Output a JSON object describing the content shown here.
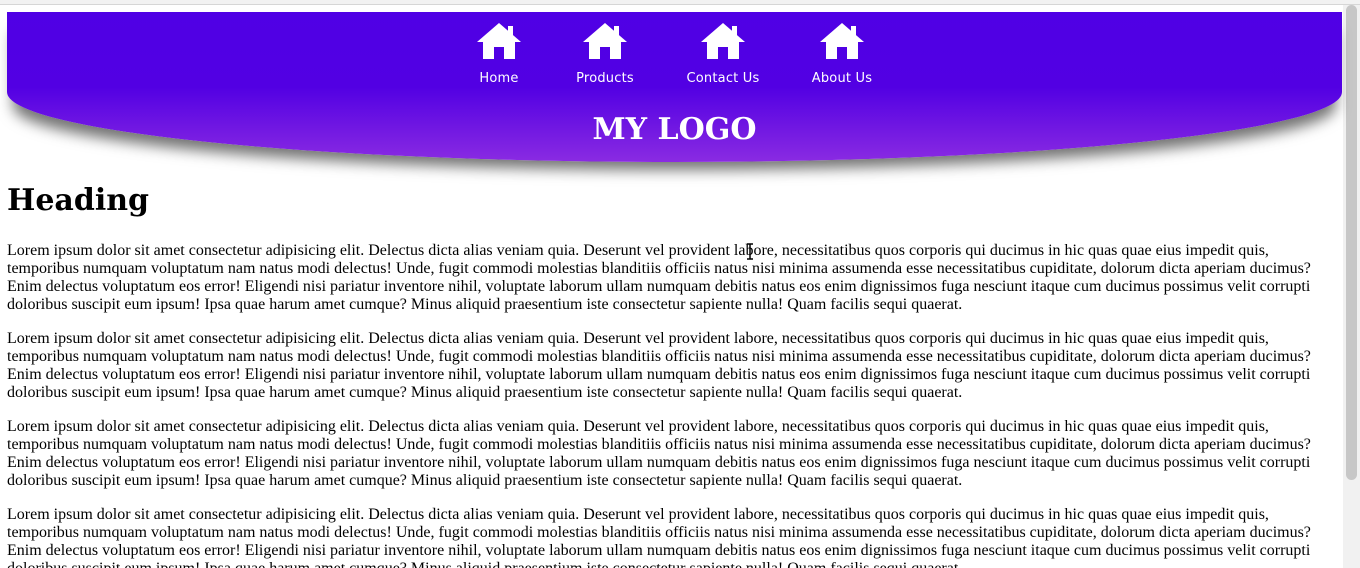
{
  "nav": {
    "items": [
      {
        "label": "Home",
        "icon": "home-icon"
      },
      {
        "label": "Products",
        "icon": "home-icon"
      },
      {
        "label": "Contact Us",
        "icon": "home-icon"
      },
      {
        "label": "About Us",
        "icon": "home-icon"
      }
    ]
  },
  "logo": {
    "text": "MY LOGO"
  },
  "colors": {
    "header_top": "#4f00e5",
    "header_bottom": "#8a2be2",
    "nav_text": "#ffffff"
  },
  "main": {
    "heading": "Heading",
    "paragraphs": [
      "Lorem ipsum dolor sit amet consectetur adipisicing elit. Delectus dicta alias veniam quia. Deserunt vel provident labore, necessitatibus quos corporis qui ducimus in hic quas quae eius impedit quis, temporibus numquam voluptatum nam natus modi delectus! Unde, fugit commodi molestias blanditiis officiis natus nisi minima assumenda esse necessitatibus cupiditate, dolorum dicta aperiam ducimus? Enim delectus voluptatum eos error! Eligendi nisi pariatur inventore nihil, voluptate laborum ullam numquam debitis natus eos enim dignissimos fuga nesciunt itaque cum ducimus possimus velit corrupti doloribus suscipit eum ipsum! Ipsa quae harum amet cumque? Minus aliquid praesentium iste consectetur sapiente nulla! Quam facilis sequi quaerat.",
      "Lorem ipsum dolor sit amet consectetur adipisicing elit. Delectus dicta alias veniam quia. Deserunt vel provident labore, necessitatibus quos corporis qui ducimus in hic quas quae eius impedit quis, temporibus numquam voluptatum nam natus modi delectus! Unde, fugit commodi molestias blanditiis officiis natus nisi minima assumenda esse necessitatibus cupiditate, dolorum dicta aperiam ducimus? Enim delectus voluptatum eos error! Eligendi nisi pariatur inventore nihil, voluptate laborum ullam numquam debitis natus eos enim dignissimos fuga nesciunt itaque cum ducimus possimus velit corrupti doloribus suscipit eum ipsum! Ipsa quae harum amet cumque? Minus aliquid praesentium iste consectetur sapiente nulla! Quam facilis sequi quaerat.",
      "Lorem ipsum dolor sit amet consectetur adipisicing elit. Delectus dicta alias veniam quia. Deserunt vel provident labore, necessitatibus quos corporis qui ducimus in hic quas quae eius impedit quis, temporibus numquam voluptatum nam natus modi delectus! Unde, fugit commodi molestias blanditiis officiis natus nisi minima assumenda esse necessitatibus cupiditate, dolorum dicta aperiam ducimus? Enim delectus voluptatum eos error! Eligendi nisi pariatur inventore nihil, voluptate laborum ullam numquam debitis natus eos enim dignissimos fuga nesciunt itaque cum ducimus possimus velit corrupti doloribus suscipit eum ipsum! Ipsa quae harum amet cumque? Minus aliquid praesentium iste consectetur sapiente nulla! Quam facilis sequi quaerat.",
      "Lorem ipsum dolor sit amet consectetur adipisicing elit. Delectus dicta alias veniam quia. Deserunt vel provident labore, necessitatibus quos corporis qui ducimus in hic quas quae eius impedit quis, temporibus numquam voluptatum nam natus modi delectus! Unde, fugit commodi molestias blanditiis officiis natus nisi minima assumenda esse necessitatibus cupiditate, dolorum dicta aperiam ducimus? Enim delectus voluptatum eos error! Eligendi nisi pariatur inventore nihil, voluptate laborum ullam numquam debitis natus eos enim dignissimos fuga nesciunt itaque cum ducimus possimus velit corrupti doloribus suscipit eum ipsum! Ipsa quae harum amet cumque? Minus aliquid praesentium iste consectetur sapiente nulla! Quam facilis sequi quaerat."
    ]
  }
}
